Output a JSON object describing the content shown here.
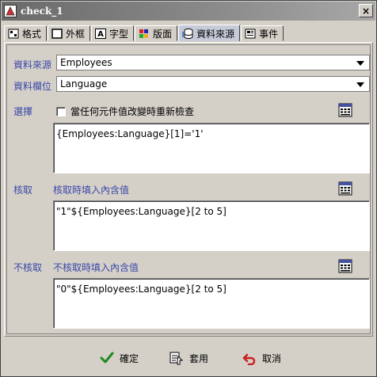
{
  "window": {
    "title": "check_1",
    "app_icon": "app-icon",
    "close_label": "×"
  },
  "tabs": [
    {
      "label": "格式",
      "icon": "format-icon"
    },
    {
      "label": "外框",
      "icon": "border-icon"
    },
    {
      "label": "字型",
      "icon": "font-icon"
    },
    {
      "label": "版面",
      "icon": "layout-icon"
    },
    {
      "label": "資料來源",
      "icon": "database-icon",
      "active": true
    },
    {
      "label": "事件",
      "icon": "event-icon"
    }
  ],
  "datasource": {
    "source_label": "資料來源",
    "source_value": "Employees",
    "field_label": "資料欄位",
    "field_value": "Language"
  },
  "select": {
    "label": "選擇",
    "checkbox_label": "當任何元件值改變時重新檢查",
    "checked": false,
    "expression": "{Employees:Language}[1]='1'"
  },
  "checked_section": {
    "label": "核取",
    "sublabel": "核取時填入內含值",
    "expression": "\"1\"${Employees:Language}[2 to 5]"
  },
  "unchecked_section": {
    "label": "不核取",
    "sublabel": "不核取時填入內含值",
    "expression": "\"0\"${Employees:Language}[2 to 5]"
  },
  "buttons": {
    "ok": "確定",
    "apply": "套用",
    "cancel": "取消"
  },
  "colors": {
    "label_blue": "#3a47a8",
    "ok_green": "#1f8a1f",
    "cancel_red": "#cc2222"
  }
}
